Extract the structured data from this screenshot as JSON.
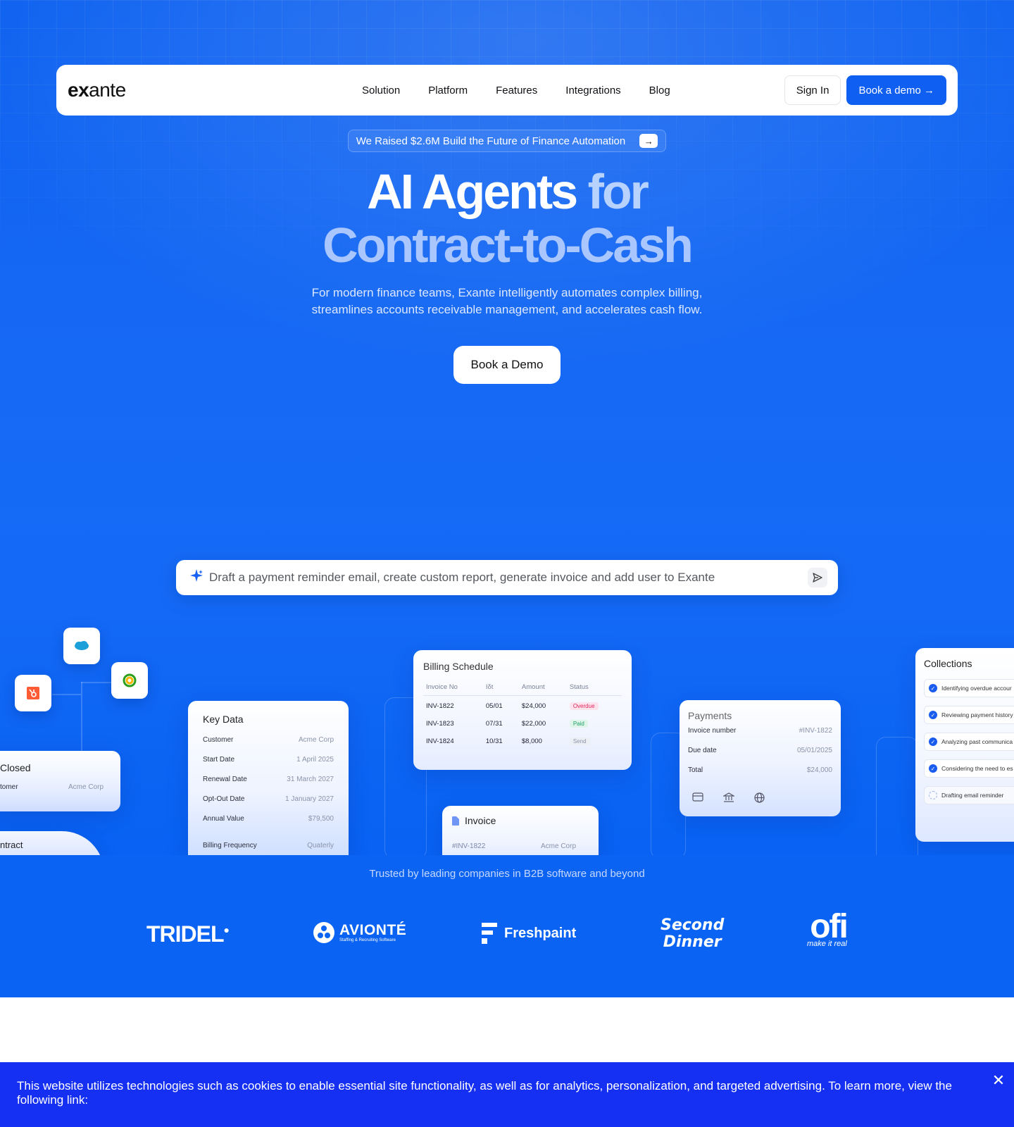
{
  "brand": {
    "logo_left": "ex",
    "logo_right": "ante"
  },
  "nav": {
    "items": [
      "Solution",
      "Platform",
      "Features",
      "Integrations",
      "Blog"
    ],
    "sign_in": "Sign In",
    "book_demo": "Book a demo →"
  },
  "announcement": {
    "text": "We Raised $2.6M Build the Future of Finance Automation",
    "arrow": "→"
  },
  "hero": {
    "title_part1": "AI Agents",
    "title_part2": "for",
    "title_line2": "Contract-to-Cash",
    "subtitle": "For modern finance teams, Exante intelligently automates complex billing, streamlines accounts receivable management, and accelerates cash flow.",
    "cta": "Book a Demo"
  },
  "prompt": {
    "placeholder": "Draft a payment reminder email, create custom report, generate invoice and add user to Exante"
  },
  "closed_card": {
    "title": "Closed",
    "label": "tomer",
    "value": "Acme Corp",
    "contract": "ntract"
  },
  "key_data": {
    "title": "Key Data",
    "rows": [
      {
        "k": "Customer",
        "v": "Acme Corp"
      },
      {
        "k": "Start Date",
        "v": "1 April 2025"
      },
      {
        "k": "Renewal Date",
        "v": "31 March 2027"
      },
      {
        "k": "Opt-Out Date",
        "v": "1 January 2027"
      },
      {
        "k": "Annual Value",
        "v": "$79,500"
      },
      {
        "k": "Billing Frequency",
        "v": "Quaterly"
      }
    ]
  },
  "billing": {
    "title": "Billing Schedule",
    "headers": [
      "Invoice No",
      "Iδt",
      "Amount",
      "Status"
    ],
    "rows": [
      {
        "no": "INV-1822",
        "date": "05/01",
        "amount": "$24,000",
        "status": "Overdue"
      },
      {
        "no": "INV-1823",
        "date": "07/31",
        "amount": "$22,000",
        "status": "Paid"
      },
      {
        "no": "INV-1824",
        "date": "10/31",
        "amount": "$8,000",
        "status": "Send"
      }
    ]
  },
  "invoice": {
    "title": "Invoice",
    "number": "#INV-1822",
    "customer": "Acme Corp"
  },
  "payments": {
    "title": "Payments",
    "rows": [
      {
        "k": "Invoice number",
        "v": "#INV-1822"
      },
      {
        "k": "Due date",
        "v": "05/01/2025"
      },
      {
        "k": "Total",
        "v": "$24,000"
      }
    ]
  },
  "collections": {
    "title": "Collections",
    "items": [
      "Identifying overdue accour",
      "Reviewing payment history",
      "Analyzing past communica",
      "Considering the need to es",
      "Drafting email reminder"
    ]
  },
  "trusted": "Trusted by leading companies in B2B software and beyond",
  "logos": {
    "tridel": "TRIDEL",
    "avionte": "AVIONTÉ",
    "avionte_sub": "Staffing & Recruiting Software",
    "freshpaint": "Freshpaint",
    "second_dinner_1": "Second",
    "second_dinner_2": "Dinner",
    "ofi": "ofi",
    "ofi_sub": "make it real"
  },
  "cookie": {
    "text": "This website utilizes technologies such as cookies to enable essential site functionality, as well as for analytics, personalization, and targeted advertising. To learn more, view the following link:",
    "close": "✕"
  },
  "colors": {
    "accent": "#0f5ff2",
    "hero_bg": "#1669f4",
    "cookie_bg": "#1530f2",
    "overdue": "#e0245e",
    "paid": "#1e9e6a"
  }
}
